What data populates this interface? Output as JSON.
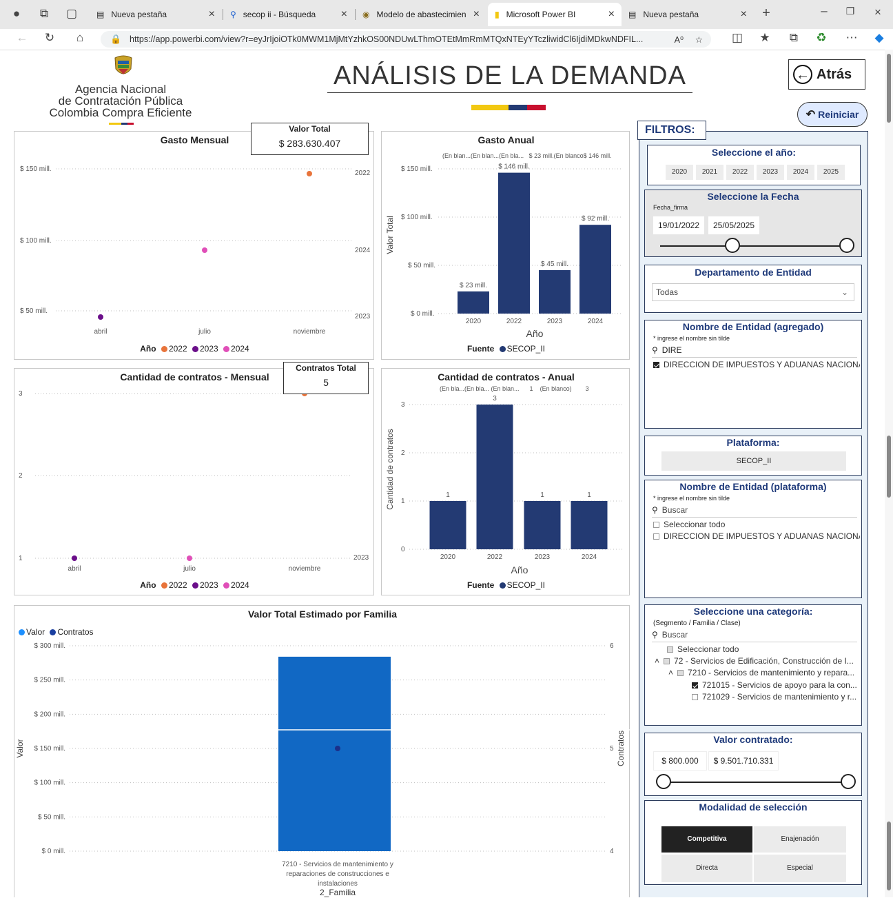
{
  "browser": {
    "tabs": [
      {
        "label": "Nueva pestaña",
        "icon": "tab-page-icon",
        "active": false
      },
      {
        "label": "secop ii - Búsqueda",
        "icon": "search-icon",
        "active": false
      },
      {
        "label": "Modelo de abastecimiento",
        "icon": "site-icon",
        "active": false
      },
      {
        "label": "Microsoft Power BI",
        "icon": "powerbi-icon",
        "active": true
      },
      {
        "label": "Nueva pestaña",
        "icon": "tab-page-icon",
        "active": false
      }
    ],
    "url": "https://app.powerbi.com/view?r=eyJrIjoiOTk0MWM1MjMtYzhkOS00NDUwLThmOTEtMmRmMTQxNTEyYTczliwidCl6IjdiMDkwNDFIL..."
  },
  "header": {
    "org_line1": "Agencia Nacional",
    "org_line2": "de Contratación Pública",
    "org_line3": "Colombia Compra Eficiente",
    "title": "ANÁLISIS DE LA DEMANDA",
    "back_label": "Atrás",
    "reset_label": "Reiniciar"
  },
  "cards": {
    "valor_total_label": "Valor Total",
    "valor_total_value": "$ 283.630.407",
    "contratos_total_label": "Contratos Total",
    "contratos_total_value": "5"
  },
  "colors": {
    "y2022": "#e8743b",
    "y2023": "#6b0f8a",
    "y2024": "#e04fb8",
    "bar": "#233a73",
    "family_bar": "#1168c4",
    "accent": "#1f3a7a"
  },
  "charts": {
    "gasto_mensual": {
      "title": "Gasto Mensual",
      "y_ticks": [
        "$ 150 mill.",
        "$ 100 mill.",
        "$ 50 mill."
      ],
      "right_labels": [
        "2022",
        "2024",
        "2023"
      ],
      "x_ticks": [
        "abril",
        "julio",
        "noviembre"
      ],
      "legend_title": "Año",
      "legend": [
        "2022",
        "2023",
        "2024"
      ]
    },
    "gasto_anual": {
      "title": "Gasto Anual",
      "top_labels": "(En blan...(En blan...(En bla...   $ 23 mill.(En blanco$ 146 mill.",
      "ylabel": "Valor Total",
      "xlabel": "Año",
      "y_ticks": [
        "$ 150 mill.",
        "$ 100 mill.",
        "$ 50 mill.",
        "$ 0 mill."
      ],
      "legend_title": "Fuente",
      "legend": "SECOP_II"
    },
    "contratos_mensual": {
      "title": "Cantidad de contratos - Mensual",
      "y_ticks": [
        "3",
        "2",
        "1"
      ],
      "right_labels": [
        "2023"
      ],
      "x_ticks": [
        "abril",
        "julio",
        "noviembre"
      ],
      "legend_title": "Año",
      "legend": [
        "2022",
        "2023",
        "2024"
      ]
    },
    "contratos_anual": {
      "title": "Cantidad de contratos - Anual",
      "top_labels": "(En bla...(En bla... (En blan...      1    (En blanco)        3",
      "ylabel": "Cantidad de contratos",
      "xlabel": "Año",
      "y_ticks": [
        "3",
        "2",
        "1",
        "0"
      ],
      "legend_title": "Fuente",
      "legend": "SECOP_II"
    },
    "familia": {
      "title": "Valor Total Estimado por Familia",
      "legend": [
        "Valor",
        "Contratos"
      ],
      "ylabel": "Valor",
      "y2label": "Contratos",
      "y_ticks": [
        "$ 300 mill.",
        "$ 250 mill.",
        "$ 200 mill.",
        "$ 150 mill.",
        "$ 100 mill.",
        "$ 50 mill.",
        "$ 0 mill."
      ],
      "y2_ticks": [
        "6",
        "5",
        "4"
      ],
      "category_line1": "7210 - Servicios de mantenimiento y",
      "category_line2": "reparaciones de construcciones e",
      "category_line3": "instalaciones",
      "xlabel": "2_Familia"
    }
  },
  "chart_data": [
    {
      "type": "scatter",
      "title": "Gasto Mensual",
      "x": [
        "abril",
        "julio",
        "noviembre"
      ],
      "series": [
        {
          "name": "2022",
          "points": [
            {
              "x": "noviembre",
              "y": 146
            }
          ]
        },
        {
          "name": "2023",
          "points": [
            {
              "x": "abril",
              "y": 45
            }
          ]
        },
        {
          "name": "2024",
          "points": [
            {
              "x": "julio",
              "y": 92
            }
          ]
        }
      ],
      "ylim": [
        40,
        160
      ]
    },
    {
      "type": "bar",
      "title": "Gasto Anual",
      "categories": [
        "2020",
        "2022",
        "2023",
        "2024"
      ],
      "values": [
        23,
        146,
        45,
        92
      ],
      "labels": [
        "$ 23 mill.",
        "$ 146 mill.",
        "$ 45 mill.",
        "$ 92 mill."
      ],
      "xlabel": "Año",
      "ylabel": "Valor Total",
      "ylim": [
        0,
        160
      ]
    },
    {
      "type": "scatter",
      "title": "Cantidad de contratos - Mensual",
      "x": [
        "abril",
        "julio",
        "noviembre"
      ],
      "series": [
        {
          "name": "2022",
          "points": [
            {
              "x": "noviembre",
              "y": 3
            }
          ]
        },
        {
          "name": "2023",
          "points": [
            {
              "x": "abril",
              "y": 1
            }
          ]
        },
        {
          "name": "2024",
          "points": [
            {
              "x": "julio",
              "y": 1
            }
          ]
        }
      ],
      "ylim": [
        1,
        3
      ]
    },
    {
      "type": "bar",
      "title": "Cantidad de contratos - Anual",
      "categories": [
        "2020",
        "2022",
        "2023",
        "2024"
      ],
      "values": [
        1,
        3,
        1,
        1
      ],
      "labels": [
        "1",
        "3",
        "1",
        "1"
      ],
      "xlabel": "Año",
      "ylabel": "Cantidad de contratos",
      "ylim": [
        0,
        3
      ]
    },
    {
      "type": "bar",
      "title": "Valor Total Estimado por Familia",
      "categories": [
        "7210 - Servicios de mantenimiento y reparaciones de construcciones e instalaciones"
      ],
      "series": [
        {
          "name": "Valor",
          "values": [
            284
          ]
        },
        {
          "name": "Contratos",
          "values": [
            5
          ]
        }
      ],
      "ylim": [
        0,
        300
      ],
      "y2lim": [
        4,
        6
      ]
    }
  ],
  "filters": {
    "title": "FILTROS:",
    "year": {
      "title": "Seleccione el año:",
      "options": [
        "2020",
        "2021",
        "2022",
        "2023",
        "2024",
        "2025"
      ]
    },
    "date": {
      "title": "Seleccione la Fecha",
      "field": "Fecha_firma",
      "from": "19/01/2022",
      "to": "25/05/2025"
    },
    "departamento": {
      "title": "Departamento de Entidad",
      "value": "Todas"
    },
    "entidad_agregado": {
      "title": "Nombre de Entidad (agregado)",
      "hint": "* ingrese el nombre sin tilde",
      "search": "DIRE",
      "item": "DIRECCION DE IMPUESTOS Y ADUANAS NACIONA..."
    },
    "plataforma": {
      "title": "Plataforma:",
      "value": "SECOP_II"
    },
    "entidad_plataforma": {
      "title": "Nombre de Entidad (plataforma)",
      "hint": "* ingrese el nombre sin tilde",
      "search_placeholder": "Buscar",
      "select_all": "Seleccionar todo",
      "item": "DIRECCION DE IMPUESTOS Y ADUANAS NACIONA..."
    },
    "categoria": {
      "title": "Seleccione una categoría:",
      "hint": "(Segmento / Familia / Clase)",
      "search_placeholder": "Buscar",
      "select_all": "Seleccionar todo",
      "tree": [
        "72 - Servicios de Edificación, Construcción de I...",
        "7210 - Servicios de mantenimiento y repara...",
        "721015 - Servicios de apoyo para la con...",
        "721029 - Servicios de mantenimiento y r..."
      ]
    },
    "valor": {
      "title": "Valor contratado:",
      "from": "$ 800.000",
      "to": "$ 9.501.710.331"
    },
    "modalidad": {
      "title": "Modalidad de selección",
      "options": [
        "Competitiva",
        "Enajenación",
        "Directa",
        "Especial"
      ],
      "selected": "Competitiva"
    }
  }
}
